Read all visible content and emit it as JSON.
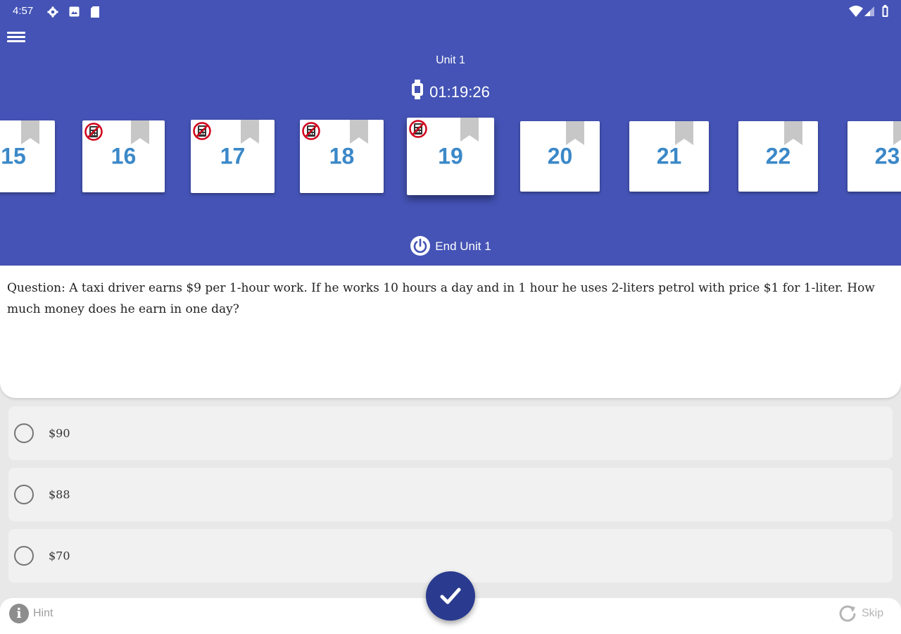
{
  "status_bar": {
    "time": "4:57",
    "icons": [
      "settings-icon",
      "image-icon",
      "sd-card-icon",
      "wifi-icon",
      "signal-icon",
      "battery-icon"
    ]
  },
  "header": {
    "menu_icon": "hamburger-menu-icon",
    "unit_title": "Unit 1",
    "timer": "01:19:26",
    "end_unit_label": "End Unit 1"
  },
  "question_cards": [
    {
      "number": "15",
      "calculator": false,
      "selected": false
    },
    {
      "number": "16",
      "calculator": true,
      "selected": false
    },
    {
      "number": "17",
      "calculator": true,
      "selected": false
    },
    {
      "number": "18",
      "calculator": true,
      "selected": false
    },
    {
      "number": "19",
      "calculator": true,
      "selected": true
    },
    {
      "number": "20",
      "calculator": false,
      "selected": false
    },
    {
      "number": "21",
      "calculator": false,
      "selected": false
    },
    {
      "number": "22",
      "calculator": false,
      "selected": false
    },
    {
      "number": "23",
      "calculator": false,
      "selected": false
    }
  ],
  "question": {
    "text": "Question: A taxi driver earns $9 per 1-hour work. If he works 10 hours a day and in 1 hour he uses 2-liters petrol with price $1 for 1-liter. How much money does he earn in one day?"
  },
  "options": [
    {
      "label": "$90"
    },
    {
      "label": "$88"
    },
    {
      "label": "$70"
    }
  ],
  "bottom_bar": {
    "hint_label": "Hint",
    "skip_label": "Skip",
    "submit_icon": "checkmark-icon"
  },
  "colors": {
    "header": "#4453b5",
    "card_number": "#3b88c8",
    "fab": "#2a3b8f"
  }
}
